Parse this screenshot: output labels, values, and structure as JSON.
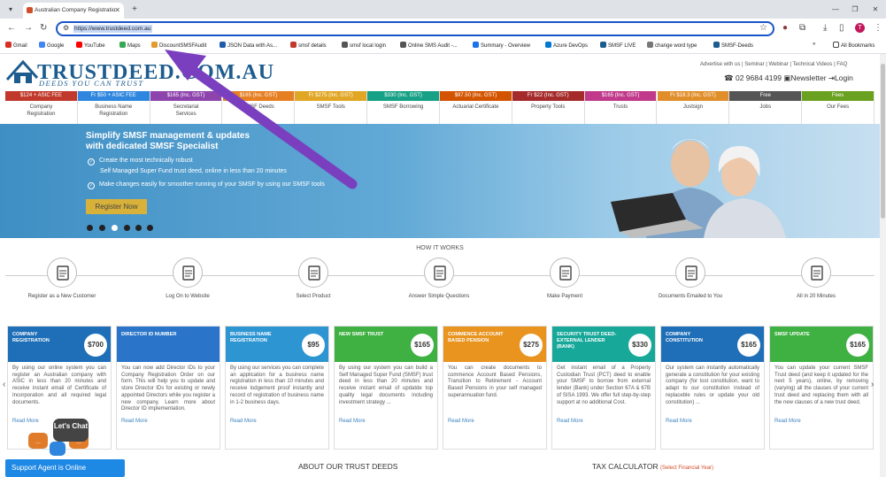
{
  "browser": {
    "tab_title": "Australian Company Registratio",
    "new_tab": "+",
    "url": "https://www.trustdeed.com.au",
    "bookmarks": [
      {
        "label": "Gmail",
        "color": "#d93025"
      },
      {
        "label": "Google",
        "color": "#4285f4"
      },
      {
        "label": "YouTube",
        "color": "#ff0000"
      },
      {
        "label": "Maps",
        "color": "#34a853"
      },
      {
        "label": "DiscountSMSFAudit",
        "color": "#e39a2d"
      },
      {
        "label": "JSON Data with As...",
        "color": "#1f5cab"
      },
      {
        "label": "smsf details",
        "color": "#c0392b"
      },
      {
        "label": "smsf local login",
        "color": "#555555"
      },
      {
        "label": "Online SMS Audit -...",
        "color": "#555555"
      },
      {
        "label": "Summary - Overview",
        "color": "#1a73e8"
      },
      {
        "label": "Azure DevOps",
        "color": "#0078d4"
      },
      {
        "label": "SMSF LIVE",
        "color": "#1d5c8e"
      },
      {
        "label": "change word type",
        "color": "#777777"
      },
      {
        "label": "SMSF-Deeds",
        "color": "#1d5c8e"
      }
    ],
    "all_bookmarks": "All Bookmarks",
    "profile_initial": "T"
  },
  "site": {
    "logo_text": "TRUSTDEED.COM.AU",
    "tagline": "DEEDS YOU CAN TRUST",
    "top_links": "Advertise with us | Seminar | Webinar | Technical Videos | FAQ",
    "phone": "02 9684 4199",
    "newsletter": "Newsletter",
    "login": "Login"
  },
  "services": [
    {
      "price": "$124 + ASIC FEE",
      "name": "Company Registration",
      "color": "#c0392b"
    },
    {
      "price": "Fr $50 + ASIC FEE",
      "name": "Business Name Registration",
      "color": "#2e86de"
    },
    {
      "price": "$165 (Inc. GST)",
      "name": "Secretarial Services",
      "color": "#8e44ad"
    },
    {
      "price": "$165 (Inc. GST)",
      "name": "SMSF Deeds",
      "color": "#e67e22"
    },
    {
      "price": "Fr $275 (Inc. GST)",
      "name": "SMSF Tools",
      "color": "#e1a624"
    },
    {
      "price": "$330 (Inc. GST)",
      "name": "SMSF Borrowing",
      "color": "#16a085"
    },
    {
      "price": "$97.50 (Inc. GST)",
      "name": "Actuarial Certificate",
      "color": "#d35400"
    },
    {
      "price": "Fr $22 (Inc. GST)",
      "name": "Property Tools",
      "color": "#a52a2a"
    },
    {
      "price": "$165 (Inc. GST)",
      "name": "Trusts",
      "color": "#c0398b"
    },
    {
      "price": "Fr $18.3 (Inc. GST)",
      "name": "Justsign",
      "color": "#e08e2a"
    },
    {
      "price": "Free",
      "name": "Jobs",
      "color": "#555555"
    },
    {
      "price": "Fees",
      "name": "Our Fees",
      "color": "#6aa121"
    }
  ],
  "hero": {
    "heading_line1": "Simplify SMSF management & updates",
    "heading_line2": "with dedicated SMSF Specialist",
    "bullet1": "Create the most technically robust",
    "bullet1b": "Self Managed Super Fund trust deed, online in less than 20 minutes",
    "bullet2": "Make changes easily for smoother running of your SMSF by using our SMSF tools",
    "button": "Register Now"
  },
  "how": {
    "title": "HOW IT WORKS",
    "steps": [
      {
        "label": "Register as a New Customer",
        "icon": "register-icon"
      },
      {
        "label": "Log On to Website",
        "icon": "login-icon"
      },
      {
        "label": "Select Product",
        "icon": "cart-icon"
      },
      {
        "label": "Answer Simple Questions",
        "icon": "questions-icon"
      },
      {
        "label": "Make Payment",
        "icon": "dollar-icon"
      },
      {
        "label": "Documents Emailed to You",
        "icon": "document-icon"
      },
      {
        "label": "All in 20 Minutes",
        "icon": "thumbs-up-icon"
      }
    ]
  },
  "cards": [
    {
      "title": "COMPANY REGISTRATION",
      "price": "$700",
      "color": "#1f6fb8",
      "body": "By using our online system you can register an Australian company with ASIC in less than 20 minutes and receive instant email of Certificate of Incorporation and all required legal documents.",
      "more": "Read More"
    },
    {
      "title": "DIRECTOR ID NUMBER",
      "price": "",
      "color": "#2a75c9",
      "body": "You can now add Director IDs to your Company Registration Order on our form. This will help you to update and store Director IDs for existing or newly appointed Directors while you register a new company. Learn more about Director ID implementation.",
      "more": "Read More"
    },
    {
      "title": "BUSINESS NAME REGISTRATION",
      "price": "$95",
      "color": "#2e95d3",
      "body": "By using our services you can complete an application for a business name registration in less than 10 minutes and receive lodgement proof instantly and record of registration of business name in 1-2 business days.",
      "more": "Read More"
    },
    {
      "title": "NEW SMSF TRUST",
      "price": "$165",
      "color": "#3fb142",
      "body": "By using our system you can build a Self Managed Super Fund (SMSF) trust deed in less than 20 minutes and receive instant email of updatde top quality legal documents including investment strategy ...",
      "more": "Read More"
    },
    {
      "title": "COMMENCE ACCOUNT BASED PENSION",
      "price": "$275",
      "color": "#e8941f",
      "body": "You can create documents to commence Account Based Pensions, Transition to Retirement - Account Based Pensions in your self managed superannuation fund.",
      "more": "Read More"
    },
    {
      "title": "SECURITY TRUST DEED-EXTERNAL LENDER (BANK)",
      "price": "$330",
      "color": "#17a89a",
      "body": "Get instant email of a Property Custodian Trust (PCT) deed to enable your SMSF to borrow from external lender (Bank) under Section 67A & 67B of SISA 1993. We offer full step-by-step support at no additional Cost.",
      "more": "Read More"
    },
    {
      "title": "COMPANY CONSTITUTION",
      "price": "$165",
      "color": "#1f6fb8",
      "body": "Our system can instantly automatically generate a constitution for your existing company (for lost constitution, want to adapt to our constitution instead of replaceble rules or update your old constitution) ...",
      "more": "Read More"
    },
    {
      "title": "SMSF UPDATE",
      "price": "$165",
      "color": "#3fb142",
      "body": "You can update your current SMSF Trust deed (and keep it updated for the next 5 years), online, by removing (varying) all the clauses of your current trust deed and replacing them with all the new clauses of a new trust deed.",
      "more": "Read More"
    }
  ],
  "footer": {
    "chat": "Support Agent is Online",
    "lets_chat": "Let's Chat",
    "about": "ABOUT OUR TRUST DEEDS",
    "tax": "TAX CALCULATOR",
    "tax_year": "(Select Financial Year)"
  }
}
